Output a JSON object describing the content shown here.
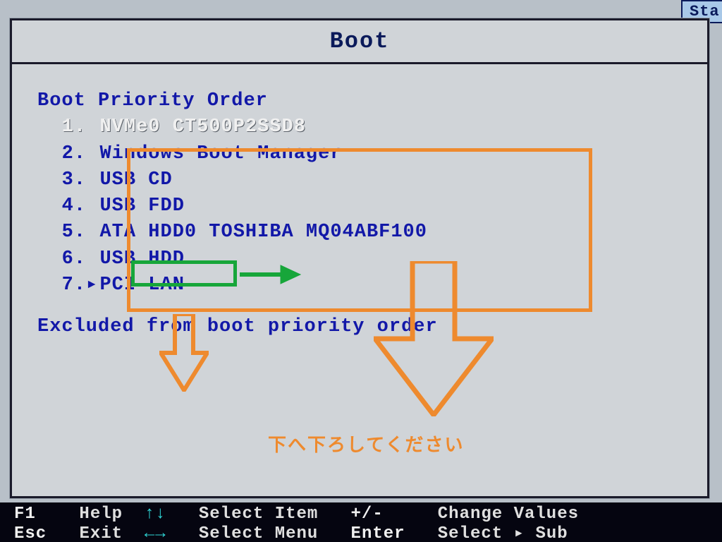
{
  "topTab": "Sta",
  "title": "Boot",
  "sectionHeader": "Boot Priority Order",
  "items": [
    {
      "n": "1",
      "marker": " ",
      "label": "NVMe0 CT500P2SSD8",
      "selected": true
    },
    {
      "n": "2",
      "marker": " ",
      "label": "Windows Boot Manager",
      "selected": false
    },
    {
      "n": "3",
      "marker": " ",
      "label": "USB CD",
      "selected": false
    },
    {
      "n": "4",
      "marker": " ",
      "label": "USB FDD",
      "selected": false
    },
    {
      "n": "5",
      "marker": " ",
      "label": "ATA HDD0 TOSHIBA MQ04ABF100",
      "selected": false
    },
    {
      "n": "6",
      "marker": " ",
      "label": "USB HDD",
      "selected": false
    },
    {
      "n": "7",
      "marker": "▸",
      "label": "PCI LAN",
      "selected": false
    }
  ],
  "excludedHeader": "Excluded from boot priority order",
  "hints": {
    "row1": {
      "k1": "F1",
      "l1": "Help",
      "a1": "↑↓",
      "l2": "Select Item",
      "k2": "+/-",
      "l3": "Change Values"
    },
    "row2": {
      "k1": "Esc",
      "l1": "Exit",
      "a1": "←→",
      "l2": "Select Menu",
      "k2": "Enter",
      "l3": "Select ▸ Sub"
    }
  },
  "annotations": {
    "instruction": "下へ下ろしてください"
  }
}
